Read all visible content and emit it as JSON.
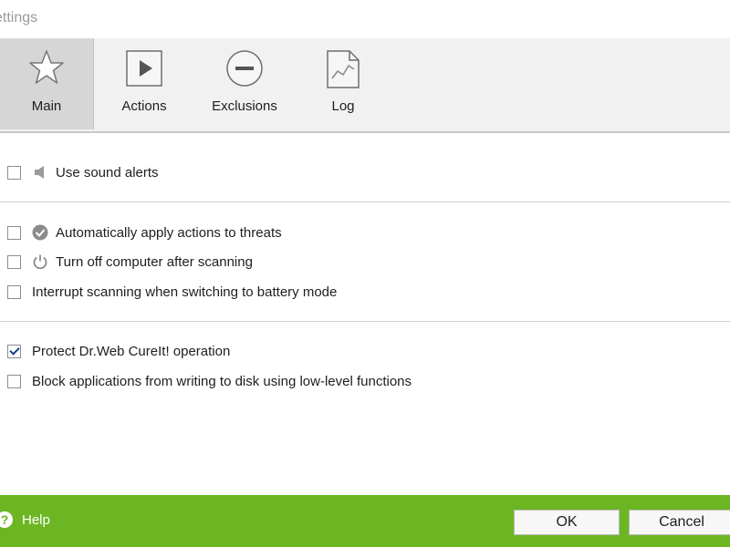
{
  "window": {
    "title": "ettings"
  },
  "tabs": [
    {
      "label": "Main",
      "icon": "star-icon",
      "active": true
    },
    {
      "label": "Actions",
      "icon": "play-icon",
      "active": false
    },
    {
      "label": "Exclusions",
      "icon": "minus-circle-icon",
      "active": false
    },
    {
      "label": "Log",
      "icon": "log-document-icon",
      "active": false
    }
  ],
  "options": {
    "sound": {
      "label": "Use sound alerts",
      "checked": false,
      "icon": "speaker-icon"
    },
    "auto_apply": {
      "label": "Automatically apply actions to threats",
      "checked": false,
      "icon": "check-circle-icon"
    },
    "turn_off": {
      "label": "Turn off computer after scanning",
      "checked": false,
      "icon": "power-icon"
    },
    "interrupt": {
      "label": "Interrupt scanning when switching to battery mode",
      "checked": false
    },
    "protect": {
      "label": "Protect Dr.Web CureIt! operation",
      "checked": true
    },
    "block": {
      "label": "Block applications from writing to disk using low-level functions",
      "checked": false
    }
  },
  "footer": {
    "help_label": "Help",
    "help_icon": "?",
    "ok_label": "OK",
    "cancel_label": "Cancel",
    "color": "#6cb624"
  }
}
